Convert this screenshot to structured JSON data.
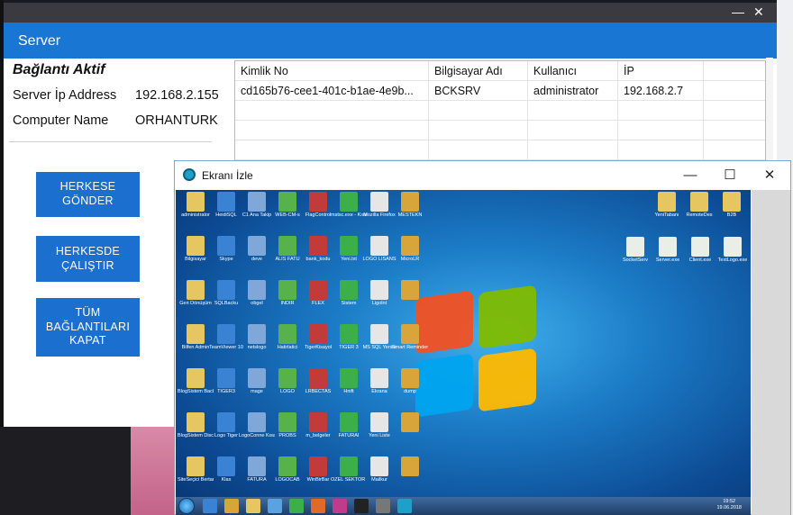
{
  "server_window": {
    "title": "Server",
    "status_title": "Bağlantı Aktif",
    "server_ip_label": "Server İp Address",
    "server_ip_value": "192.168.2.155",
    "computer_name_label": "Computer Name",
    "computer_name_value": "ORHANTURK",
    "window_controls": {
      "minimize": "—",
      "close": "✕"
    },
    "buttons": {
      "send_all": [
        "HERKESE",
        "GÖNDER"
      ],
      "run_all": [
        "HERKESDE",
        "ÇALIŞTIR"
      ],
      "close_all": [
        "TÜM",
        "BAĞLANTILARI",
        "KAPAT"
      ]
    },
    "grid": {
      "columns": [
        "Kimlik No",
        "Bilgisayar Adı",
        "Kullanıcı",
        "İP",
        ""
      ],
      "rows": [
        [
          "cd165b76-cee1-401c-b1ae-4e9b...",
          "BCKSRV",
          "administrator",
          "192.168.2.7",
          ""
        ]
      ]
    }
  },
  "izle_window": {
    "title": "Ekranı İzle",
    "controls": {
      "minimize": "—",
      "maximize": "☐",
      "close": "✕"
    },
    "desktop_icons": [
      "administrator",
      "HeidiSQL",
      "C1 Ana Takip",
      "WEB-CM-s",
      "FlagControl",
      "mstsc.exe - Kısayol",
      "Mozilla Firefox",
      "MESTEKN",
      "Bilgisayar",
      "Skype",
      "deve",
      "ALIS FATU",
      "bank_kodu",
      "Yeni.txt",
      "LOGO LISANS",
      "MicroLR",
      "Geri Dönüşüm",
      "SQLBacku",
      "obgel",
      "İNDİR",
      "FLEX",
      "Sistem",
      "Ligolnt",
      "",
      "Bilfen Admin",
      "TeamViewer 10",
      "netslogo",
      "Hatirlatici",
      "TigerKisayol",
      "TIGER 3",
      "MS SQL Yenile",
      "Smart Reminder",
      "BlogSistem Backup",
      "TIGER3",
      "mage",
      "LOGO",
      "LRBECTAS",
      "Hnift",
      "Ekrana",
      "dump",
      "BlogSistem Discovery",
      "Logo Tiger",
      "LogoConne Kısayol",
      "PROBS",
      "m_belgeler",
      "FATURAI",
      "Yeni Liste",
      "",
      "SiteSeçici Bertar",
      "Klas",
      "FATURA",
      "LOGOCAB",
      "WinBirBar",
      "OZEL SEKTOR FATURA",
      "Mailkur",
      ""
    ],
    "right_icons": [
      "YeniTabanı",
      "RemoteDes",
      "B2B",
      "SocketServ",
      "Server.exe",
      "Client.exe",
      "TextLogo.exe"
    ],
    "taskbar_time": "19:52",
    "taskbar_date": "19.06.2018"
  },
  "colors": {
    "header_blue": "#1976d2",
    "button_blue": "#1b6fcf"
  }
}
